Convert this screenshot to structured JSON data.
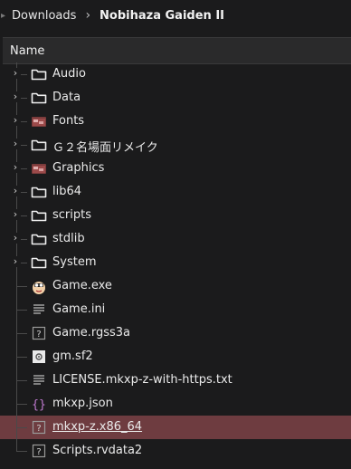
{
  "breadcrumb": {
    "parent": "Downloads",
    "separator": "›",
    "current": "Nobihaza Gaiden II"
  },
  "header": {
    "name_label": "Name"
  },
  "items": [
    {
      "label": "Audio",
      "icon": "folder-icon",
      "expandable": true
    },
    {
      "label": "Data",
      "icon": "folder-icon",
      "expandable": true
    },
    {
      "label": "Fonts",
      "icon": "custom-folder-icon",
      "expandable": true
    },
    {
      "label": "Ｇ２名場面リメイク",
      "icon": "folder-icon",
      "expandable": true
    },
    {
      "label": "Graphics",
      "icon": "custom-folder-icon",
      "expandable": true
    },
    {
      "label": "lib64",
      "icon": "folder-icon",
      "expandable": true
    },
    {
      "label": "scripts",
      "icon": "folder-icon",
      "expandable": true
    },
    {
      "label": "stdlib",
      "icon": "folder-icon",
      "expandable": true
    },
    {
      "label": "System",
      "icon": "folder-icon",
      "expandable": true
    },
    {
      "label": "Game.exe",
      "icon": "doraemon-app-icon",
      "expandable": false
    },
    {
      "label": "Game.ini",
      "icon": "text-file-icon",
      "expandable": false
    },
    {
      "label": "Game.rgss3a",
      "icon": "unknown-file-icon",
      "expandable": false
    },
    {
      "label": "gm.sf2",
      "icon": "settings-file-icon",
      "expandable": false
    },
    {
      "label": "LICENSE.mkxp-z-with-https.txt",
      "icon": "text-file-icon",
      "expandable": false
    },
    {
      "label": "mkxp.json",
      "icon": "json-file-icon",
      "expandable": false
    },
    {
      "label": "mkxp-z.x86_64",
      "icon": "unknown-file-icon",
      "expandable": false,
      "selected": true
    },
    {
      "label": "Scripts.rvdata2",
      "icon": "unknown-file-icon",
      "expandable": false
    }
  ],
  "colors": {
    "background": "#1b1b1c",
    "selection": "#6e3c40",
    "header": "#2a2a2b"
  }
}
